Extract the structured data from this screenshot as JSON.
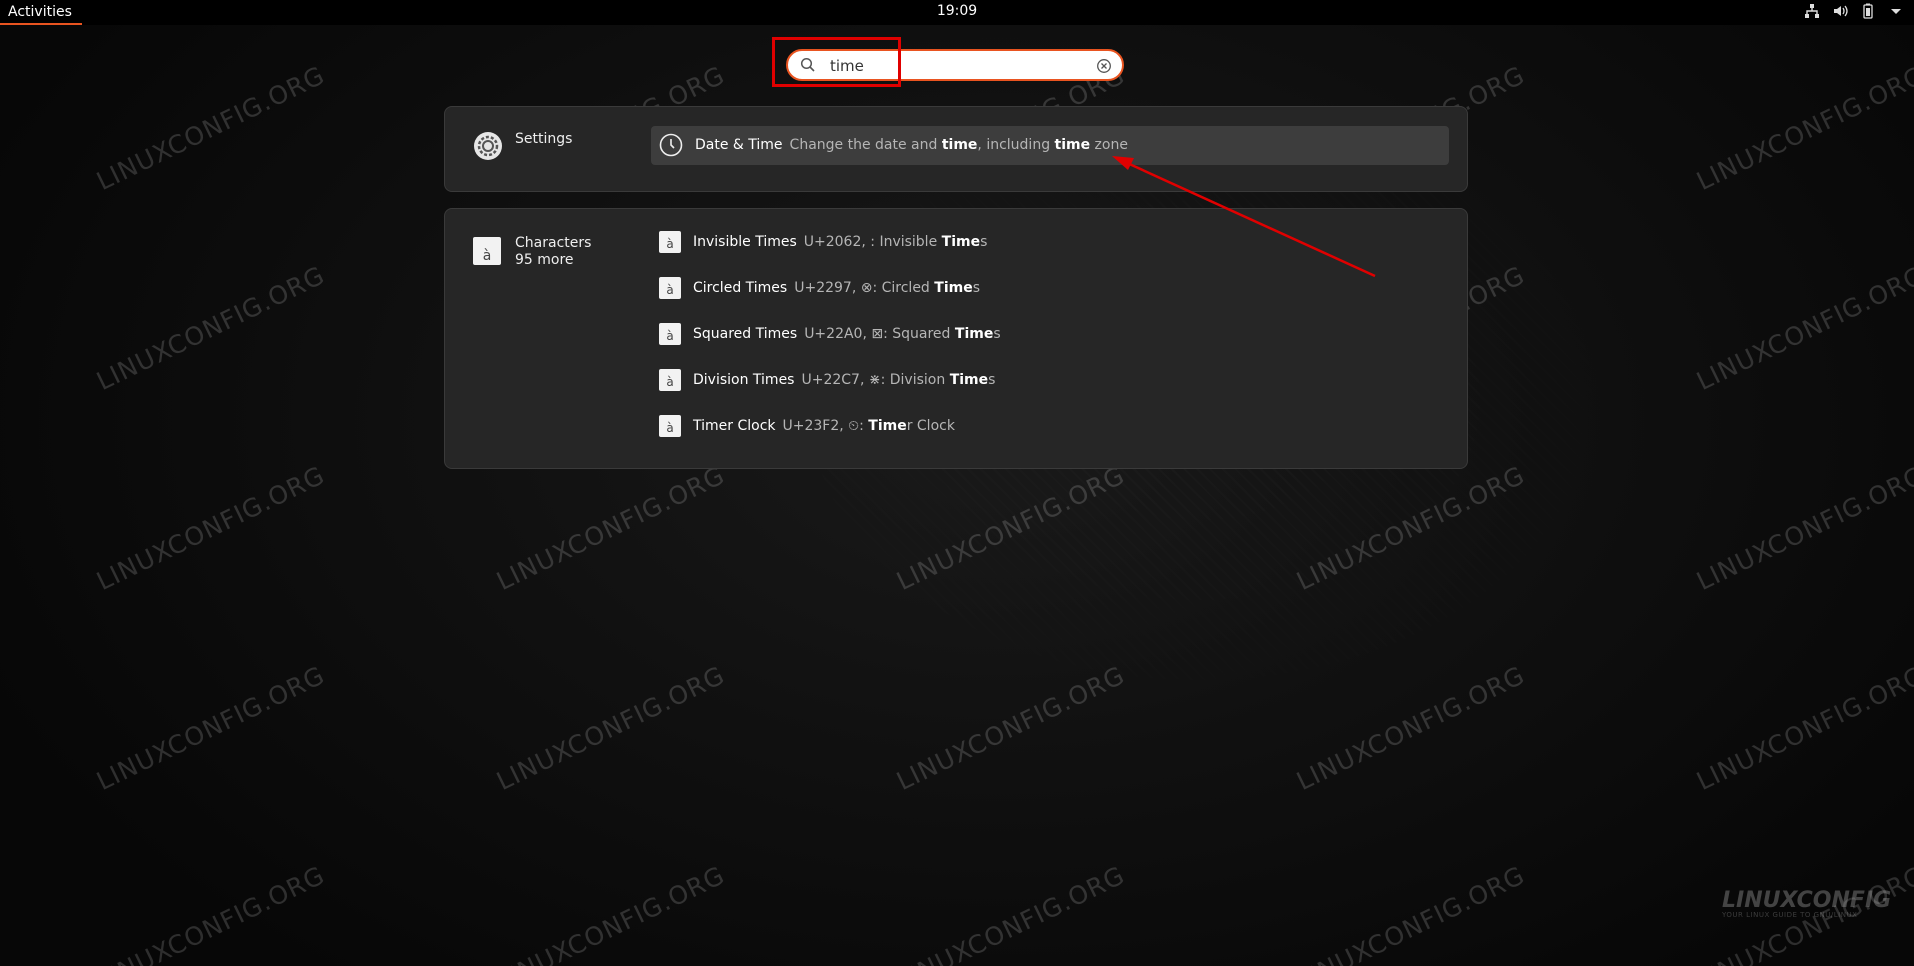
{
  "topbar": {
    "activities_label": "Activities",
    "clock": "19:09",
    "tray_icons": [
      "network-icon",
      "volume-icon",
      "battery-icon",
      "dropdown-icon"
    ]
  },
  "search": {
    "value": "time",
    "placeholder": ""
  },
  "settings_group": {
    "app_name": "Settings",
    "result": {
      "title": "Date & Time",
      "desc_parts": [
        "Change the date and ",
        "time",
        ", including ",
        "time",
        " zone"
      ]
    }
  },
  "characters_group": {
    "app_name": "Characters",
    "more": "95 more",
    "items": [
      {
        "title": "Invisible Times",
        "pre": "U+2062, : Invisible ",
        "bold": "Time",
        "post": "s"
      },
      {
        "title": "Circled Times",
        "pre": "U+2297, ⊗: Circled ",
        "bold": "Time",
        "post": "s"
      },
      {
        "title": "Squared Times",
        "pre": "U+22A0, ⊠: Squared ",
        "bold": "Time",
        "post": "s"
      },
      {
        "title": "Division Times",
        "pre": "U+22C7, ⋇: Division ",
        "bold": "Time",
        "post": "s"
      },
      {
        "title": "Timer Clock",
        "pre": "U+23F2, ⏲: ",
        "bold": "Time",
        "post": "r Clock"
      }
    ],
    "char_icon_glyph": "à"
  },
  "watermark": "LINUXCONFIG.ORG",
  "logo": {
    "text": "LINUXCONFIG",
    "tagline": "YOUR LINUX GUIDE TO GNU/LINUX"
  },
  "colors": {
    "accent": "#e95420",
    "annotation_red": "#e00000"
  }
}
